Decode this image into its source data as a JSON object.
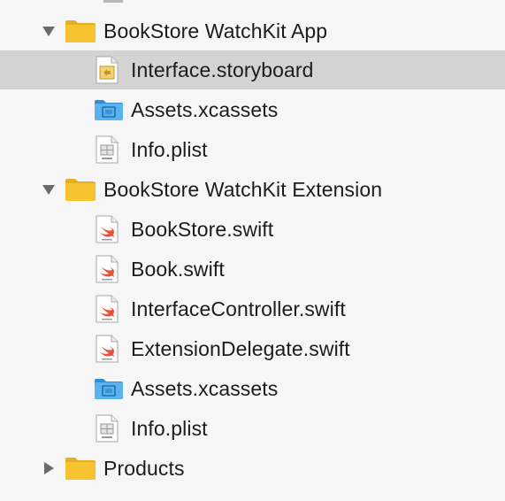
{
  "navigator": {
    "groups": [
      {
        "name": "BookStore WatchKit App",
        "expanded": true,
        "icon": "yellow-folder-icon",
        "files": [
          {
            "name": "Interface.storyboard",
            "icon": "storyboard-file-icon",
            "selected": true
          },
          {
            "name": "Assets.xcassets",
            "icon": "asset-catalog-icon",
            "selected": false
          },
          {
            "name": "Info.plist",
            "icon": "plist-file-icon",
            "selected": false
          }
        ]
      },
      {
        "name": "BookStore WatchKit Extension",
        "expanded": true,
        "icon": "yellow-folder-icon",
        "files": [
          {
            "name": "BookStore.swift",
            "icon": "swift-file-icon",
            "selected": false
          },
          {
            "name": "Book.swift",
            "icon": "swift-file-icon",
            "selected": false
          },
          {
            "name": "InterfaceController.swift",
            "icon": "swift-file-icon",
            "selected": false
          },
          {
            "name": "ExtensionDelegate.swift",
            "icon": "swift-file-icon",
            "selected": false
          },
          {
            "name": "Assets.xcassets",
            "icon": "asset-catalog-icon",
            "selected": false
          },
          {
            "name": "Info.plist",
            "icon": "plist-file-icon",
            "selected": false
          }
        ]
      },
      {
        "name": "Products",
        "expanded": false,
        "icon": "yellow-folder-icon",
        "files": []
      }
    ]
  },
  "colors": {
    "background": "#f6f6f6",
    "selection": "#d3d3d3",
    "folder": "#f7c331",
    "asset_catalog": "#4aa8e8",
    "swift": "#e8513a",
    "text": "#1c1c1c"
  }
}
